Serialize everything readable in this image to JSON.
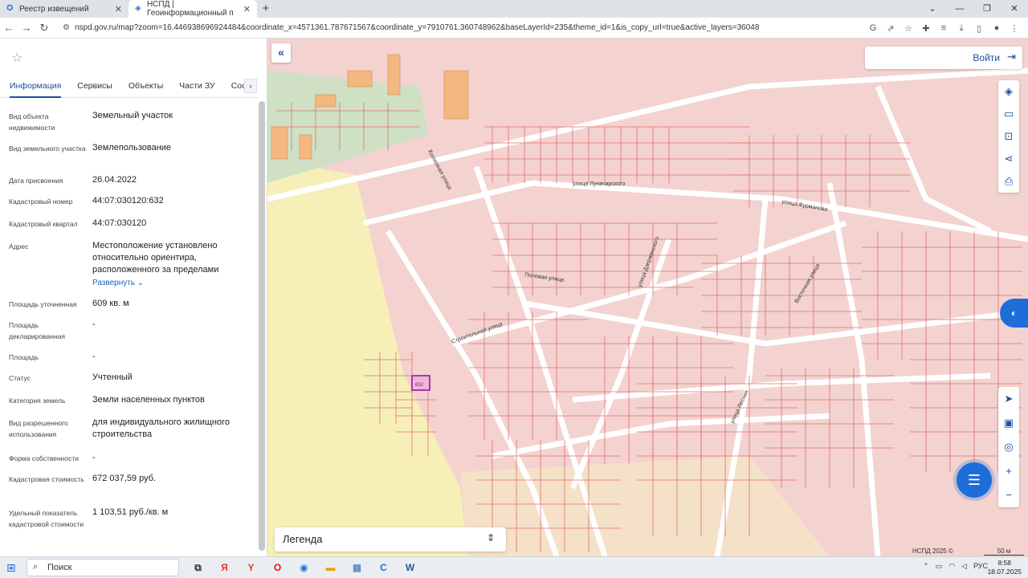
{
  "browser": {
    "tabs": [
      {
        "title": "Реестр извещений"
      },
      {
        "title": "НСПД | Геоинформационный п"
      }
    ],
    "url": "nspd.gov.ru/map?zoom=16.446938696924484&coordinate_x=4571361.787671567&coordinate_y=7910761.360748962&baseLayerId=235&theme_id=1&is_copy_url=true&active_layers=36048",
    "window_controls": [
      "⌄",
      "—",
      "❐",
      "✕"
    ]
  },
  "panel": {
    "tabs": [
      "Информация",
      "Сервисы",
      "Объекты",
      "Части ЗУ",
      "Соста"
    ],
    "active_tab": "Информация",
    "rows": [
      {
        "label": "Вид объекта недвижимости",
        "value": "Земельный участок"
      },
      {
        "label": "Вид земельного участка",
        "value": "Землепользование"
      },
      {
        "label": "Дата присвоения",
        "value": "26.04.2022"
      },
      {
        "label": "Кадастровый номер",
        "value": "44:07:030120:632"
      },
      {
        "label": "Кадастровый квартал",
        "value": "44:07:030120"
      },
      {
        "label": "Адрес",
        "value": "Местоположение установлено относительно ориентира, расположенного за пределами",
        "link": "Развернуть"
      },
      {
        "label": "Площадь уточненная",
        "value": "609 кв. м"
      },
      {
        "label": "Площадь декларированная",
        "value": "-"
      },
      {
        "label": "Площадь",
        "value": "-"
      },
      {
        "label": "Статус",
        "value": "Учтенный"
      },
      {
        "label": "Категория земель",
        "value": "Земли населенных пунктов"
      },
      {
        "label": "Вид разрешенного использования",
        "value": "для индивидуального жилищного строительства"
      },
      {
        "label": "Форма собственности",
        "value": "-"
      },
      {
        "label": "Кадастровая стоимость",
        "value": "672 037,59 руб."
      },
      {
        "label": "Удельный показатель кадастровой стоимости",
        "value": "1 103,51 руб./кв. м"
      }
    ]
  },
  "map": {
    "login_label": "Войти",
    "legend_label": "Легенда",
    "copyright": "НСПД 2025 ©",
    "scale_label": "50 м",
    "street_labels": [
      "Колхозная улица",
      "улица Луначарского",
      "улица Фурманова",
      "Полевая улица",
      "Строительная улица",
      "улица Дзержинского",
      "улица Лесная",
      "Восточная улица"
    ],
    "selected_parcel": "632"
  },
  "taskbar": {
    "search_label": "Поиск",
    "lang": "РУС",
    "time": "8:58",
    "date": "18.07.2025"
  }
}
